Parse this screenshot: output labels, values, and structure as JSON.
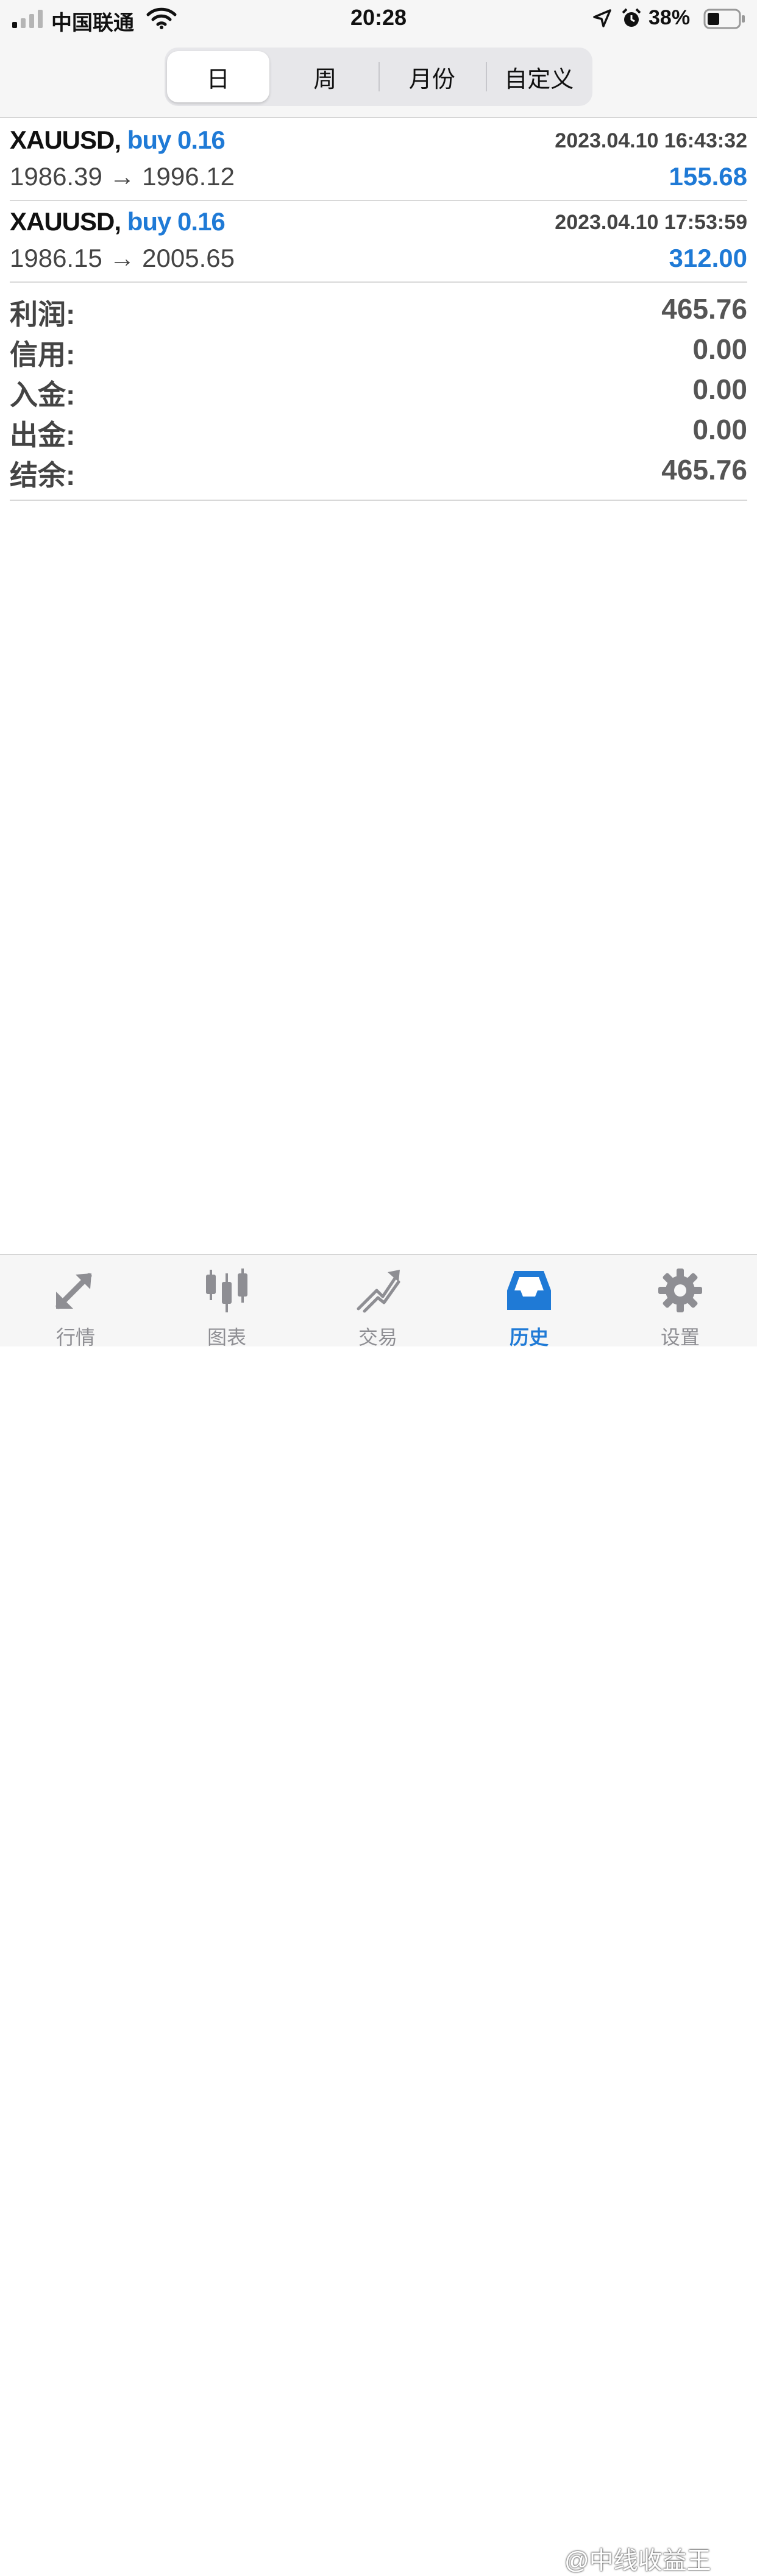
{
  "status_bar": {
    "carrier": "中国联通",
    "time": "20:28",
    "battery": "38%"
  },
  "segments": [
    {
      "label": "日",
      "active": true
    },
    {
      "label": "周",
      "active": false
    },
    {
      "label": "月份",
      "active": false
    },
    {
      "label": "自定义",
      "active": false
    }
  ],
  "trades": [
    {
      "symbol": "XAUUSD,",
      "direction": "buy 0.16",
      "time": "2023.04.10 16:43:32",
      "prices": "1986.39 → 1996.12",
      "profit": "155.68"
    },
    {
      "symbol": "XAUUSD,",
      "direction": "buy 0.16",
      "time": "2023.04.10 17:53:59",
      "prices": "1986.15 → 2005.65",
      "profit": "312.00"
    }
  ],
  "summary": [
    {
      "label": "利润:",
      "value": "465.76"
    },
    {
      "label": "信用:",
      "value": "0.00"
    },
    {
      "label": "入金:",
      "value": "0.00"
    },
    {
      "label": "出金:",
      "value": "0.00"
    },
    {
      "label": "结余:",
      "value": "465.76"
    }
  ],
  "tabs": [
    {
      "label": "行情",
      "icon": "quotes-arrows-icon"
    },
    {
      "label": "图表",
      "icon": "candlestick-chart-icon"
    },
    {
      "label": "交易",
      "icon": "trade-trend-icon"
    },
    {
      "label": "历史",
      "icon": "history-inbox-icon",
      "active": true
    },
    {
      "label": "设置",
      "icon": "gear-icon"
    }
  ],
  "watermark": "@中线收益王",
  "colors": {
    "accent": "#1f7ad6",
    "inactive": "#8e8e93"
  }
}
